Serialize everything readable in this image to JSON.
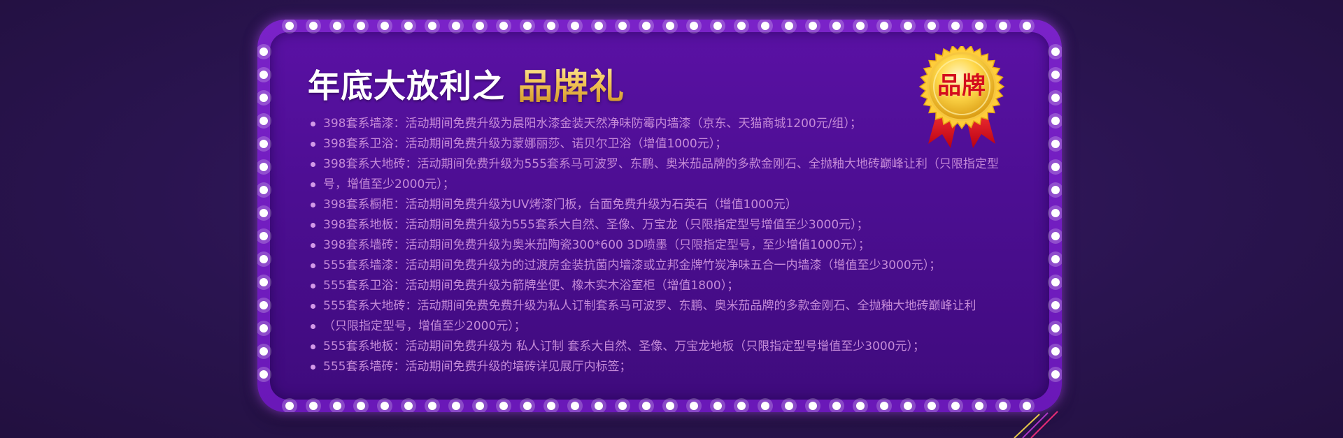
{
  "title": {
    "main": "年底大放利之",
    "accent": "品牌礼"
  },
  "badge": {
    "label": "品牌"
  },
  "items": [
    "398套系墙漆：活动期间免费升级为晨阳水漆金装天然净味防霉内墙漆（京东、天猫商城1200元/组）；",
    "398套系卫浴：活动期间免费升级为蒙娜丽莎、诺贝尔卫浴（增值1000元）；",
    "398套系大地砖：活动期间免费升级为555套系马可波罗、东鹏、奥米茄品牌的多款金刚石、全抛釉大地砖巅峰让利（只限指定型",
    "号，增值至少2000元）；",
    "398套系橱柜：活动期间免费升级为UV烤漆门板，台面免费升级为石英石（增值1000元）",
    "398套系地板：活动期间免费升级为555套系大自然、圣像、万宝龙（只限指定型号增值至少3000元）；",
    "398套系墙砖：活动期间免费升级为奥米茄陶瓷300*600 3D喷墨（只限指定型号，至少增值1000元）；",
    "555套系墙漆：活动期间免费升级为的过渡房金装抗菌内墙漆或立邦金牌竹炭净味五合一内墙漆（增值至少3000元）；",
    "555套系卫浴：活动期间免费升级为箭牌坐便、橡木实木浴室柜（增值1800）；",
    "555套系大地砖：活动期间免费免费升级为私人订制套系马可波罗、东鹏、奥米茄品牌的多款金刚石、全抛釉大地砖巅峰让利",
    "（只限指定型号，增值至少2000元）；",
    "555套系地板：活动期间免费升级为 私人订制 套系大自然、圣像、万宝龙地板（只限指定型号增值至少3000元）；",
    "555套系墙砖：活动期间免费升级的墙砖详见展厅内标签；"
  ],
  "colors": {
    "background": "#2a1450",
    "frame": "#7a22c8",
    "panel": "#4c0e92",
    "text": "#c58ad8",
    "gold": "#f3c75a",
    "badge_red": "#d40d1c"
  },
  "icons": {
    "badge": "gold-seal-ribbon-icon",
    "bulbs": "marquee-light-icon"
  }
}
